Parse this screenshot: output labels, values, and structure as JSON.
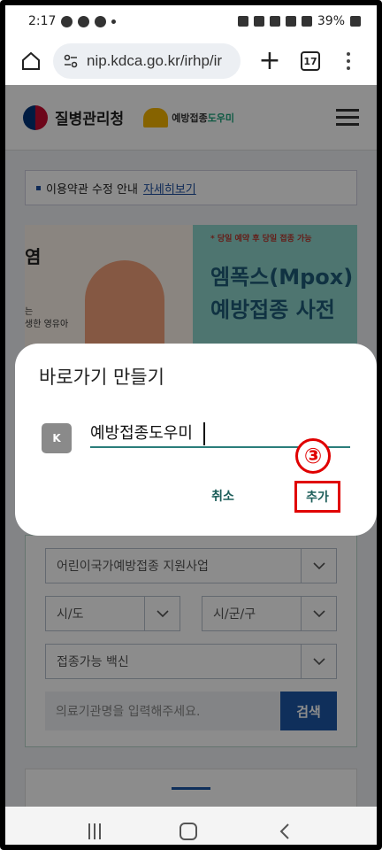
{
  "status_bar": {
    "time": "2:17",
    "battery": "39%"
  },
  "browser": {
    "url": "nip.kdca.go.kr/irhp/ir",
    "tab_count": "17"
  },
  "site": {
    "kdca_name": "질병관리청",
    "nip_name_prefix": "예방접종",
    "nip_name_highlight": "도우미",
    "notice_text": "이용약관 수정 안내",
    "notice_link": "자세히보기",
    "banner": {
      "left_big": "염",
      "left_small_1": "는",
      "left_small_2": "생한 영유아",
      "right_note": "* 당일 예약 후 당일 접종 가능",
      "right_title_1": "엠폭스(Mpox)",
      "right_title_2": "예방접종 사전"
    },
    "search": {
      "program_select": "어린이국가예방접종 지원사업",
      "sido_select": "시/도",
      "sigungu_select": "시/군/구",
      "vaccine_select": "접종가능 백신",
      "placeholder": "의료기관명을 입력해주세요.",
      "search_button": "검색"
    }
  },
  "dialog": {
    "title": "바로가기 만들기",
    "icon_letter": "K",
    "name_value": "예방접종도우미",
    "step_marker": "③",
    "cancel_label": "취소",
    "add_label": "추가",
    "accent_color": "#2b7d7a",
    "highlight_color": "#e00000"
  }
}
